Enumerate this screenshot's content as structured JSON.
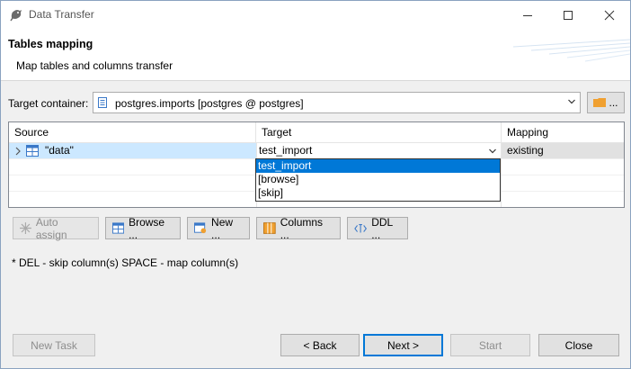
{
  "window": {
    "title": "Data Transfer"
  },
  "header": {
    "title": "Tables mapping",
    "subtitle": "Map tables and columns transfer"
  },
  "target_container": {
    "label": "Target container:",
    "value": "postgres.imports  [postgres @ postgres]",
    "button_label": "..."
  },
  "grid": {
    "columns": [
      "Source",
      "Target",
      "Mapping"
    ],
    "rows": [
      {
        "source": "\"data\"",
        "target": "test_import",
        "mapping": "existing"
      }
    ]
  },
  "dropdown": {
    "options": [
      "test_import",
      "[browse]",
      "[skip]"
    ]
  },
  "toolbar": {
    "auto_assign": "Auto assign",
    "browse": "Browse ...",
    "new": "New ...",
    "columns": "Columns ...",
    "ddl": "DDL ..."
  },
  "hint": "* DEL - skip column(s)  SPACE - map column(s)",
  "footer": {
    "new_task": "New Task",
    "back": "< Back",
    "next": "Next >",
    "start": "Start",
    "close": "Close"
  },
  "colors": {
    "selection": "#cce8ff",
    "accent": "#0078d7",
    "folder": "#f0a030"
  }
}
